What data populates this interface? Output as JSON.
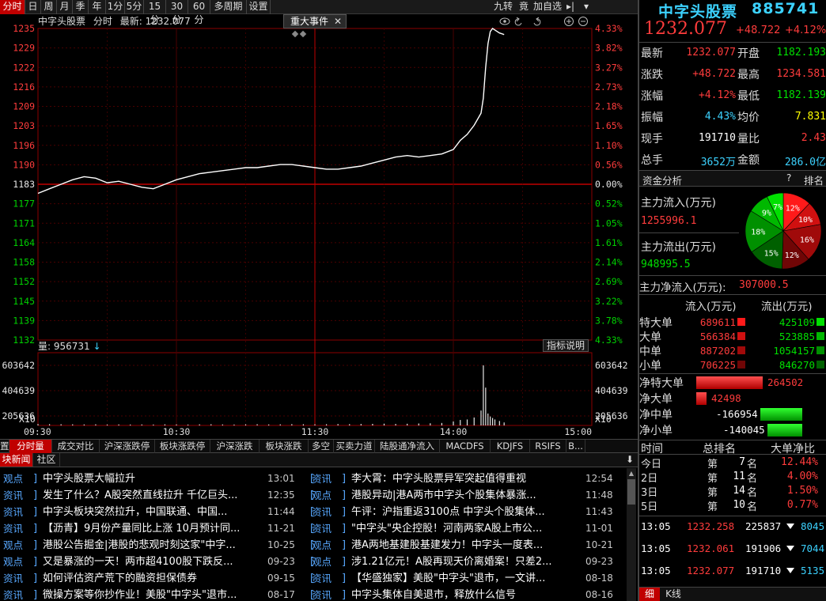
{
  "top_tabs": [
    "分时",
    "日",
    "周",
    "月",
    "季",
    "年",
    "1分",
    "5分",
    "15分",
    "30分",
    "60分",
    "多周期",
    "设置"
  ],
  "top_right_tools": [
    "九转",
    "竟",
    "加自选",
    "▸|",
    "▾"
  ],
  "chart_header": {
    "title": "中字头股票",
    "mode": "分时",
    "latest_label": "最新:",
    "latest_value": "1232.077",
    "event_button": "重大事件",
    "event_close": "✕",
    "icons": [
      "eye-icon",
      "undo-icon",
      "redo-icon",
      "zoom-in-icon",
      "zoom-out-icon"
    ]
  },
  "chart_data": {
    "type": "line",
    "price_axis_ticks": [
      "1235",
      "1229",
      "1222",
      "1216",
      "1209",
      "1203",
      "1196",
      "1190",
      "1183",
      "1177",
      "1171",
      "1164",
      "1158",
      "1152",
      "1145",
      "1139",
      "1132"
    ],
    "pct_axis_ticks": [
      "4.33%",
      "3.82%",
      "3.27%",
      "2.73%",
      "2.18%",
      "1.65%",
      "1.10%",
      "0.56%",
      "0.00%",
      "0.52%",
      "1.05%",
      "1.61%",
      "2.14%",
      "2.69%",
      "3.22%",
      "3.78%",
      "4.33%"
    ],
    "price_range": [
      1132,
      1235
    ],
    "prev_close": 1183,
    "time_ticks": [
      "09:30",
      "10:30",
      "11:30",
      "14:00",
      "15:00"
    ],
    "volume_label": "量:",
    "volume_value": "956731",
    "volume_axis_ticks": [
      "603642",
      "404639",
      "205636",
      "X10"
    ],
    "volume_max": 603642,
    "indicator_button": "指标说明",
    "price_series": [
      [
        0,
        1180.5
      ],
      [
        5,
        1182
      ],
      [
        10,
        1183.5
      ],
      [
        15,
        1185
      ],
      [
        20,
        1186
      ],
      [
        25,
        1185.5
      ],
      [
        30,
        1184
      ],
      [
        35,
        1184.5
      ],
      [
        40,
        1183.5
      ],
      [
        45,
        1182.5
      ],
      [
        50,
        1182
      ],
      [
        55,
        1183.5
      ],
      [
        60,
        1185
      ],
      [
        65,
        1186
      ],
      [
        70,
        1187
      ],
      [
        75,
        1187.5
      ],
      [
        80,
        1188
      ],
      [
        85,
        1188.5
      ],
      [
        90,
        1189
      ],
      [
        95,
        1189
      ],
      [
        100,
        1189.5
      ],
      [
        105,
        1190
      ],
      [
        110,
        1190
      ],
      [
        115,
        1189.5
      ],
      [
        120,
        1189
      ],
      [
        125,
        1188.5
      ],
      [
        130,
        1188.5
      ],
      [
        135,
        1189
      ],
      [
        140,
        1189.5
      ],
      [
        145,
        1190.5
      ],
      [
        150,
        1191.5
      ],
      [
        155,
        1192.5
      ],
      [
        160,
        1193
      ],
      [
        165,
        1192.5
      ],
      [
        170,
        1193
      ],
      [
        175,
        1193.5
      ],
      [
        180,
        1195
      ],
      [
        183,
        1198
      ],
      [
        186,
        1200
      ],
      [
        189,
        1203
      ],
      [
        192,
        1207
      ],
      [
        193,
        1212
      ],
      [
        194,
        1222
      ],
      [
        195,
        1230
      ],
      [
        196,
        1234
      ],
      [
        197,
        1235
      ],
      [
        198,
        1234.5
      ],
      [
        200,
        1233.5
      ],
      [
        202,
        1233
      ]
    ],
    "volume_series": [
      [
        0,
        14000
      ],
      [
        5,
        13000
      ],
      [
        10,
        12000
      ],
      [
        15,
        11000
      ],
      [
        20,
        10000
      ],
      [
        25,
        11000
      ],
      [
        30,
        9000
      ],
      [
        35,
        10000
      ],
      [
        40,
        9000
      ],
      [
        45,
        10000
      ],
      [
        50,
        9000
      ],
      [
        55,
        11000
      ],
      [
        60,
        10000
      ],
      [
        65,
        9000
      ],
      [
        70,
        11000
      ],
      [
        75,
        12000
      ],
      [
        80,
        10000
      ],
      [
        85,
        9000
      ],
      [
        90,
        11000
      ],
      [
        95,
        12000
      ],
      [
        100,
        10000
      ],
      [
        105,
        11000
      ],
      [
        110,
        13000
      ],
      [
        115,
        12000
      ],
      [
        120,
        11000
      ],
      [
        125,
        12000
      ],
      [
        130,
        14000
      ],
      [
        135,
        13000
      ],
      [
        140,
        15000
      ],
      [
        145,
        16000
      ],
      [
        150,
        18000
      ],
      [
        155,
        15000
      ],
      [
        160,
        17000
      ],
      [
        165,
        20000
      ],
      [
        170,
        22000
      ],
      [
        175,
        25000
      ],
      [
        180,
        40000
      ],
      [
        183,
        55000
      ],
      [
        186,
        60000
      ],
      [
        189,
        80000
      ],
      [
        192,
        150000
      ],
      [
        193,
        603642
      ],
      [
        194,
        380000
      ],
      [
        195,
        120000
      ],
      [
        196,
        90000
      ],
      [
        197,
        75000
      ],
      [
        198,
        60000
      ],
      [
        200,
        45000
      ],
      [
        202,
        30000
      ]
    ]
  },
  "analysis_tabs": [
    "置",
    "分时量",
    "成交对比",
    "沪深涨跌停",
    "板块涨跌停",
    "沪深涨跌",
    "板块涨跌",
    "多空",
    "买卖力道",
    "陆股通净流入",
    "MACDFS",
    "KDJFS",
    "RSIFS",
    "B..."
  ],
  "news_tabs": [
    "块新闻",
    "社区"
  ],
  "news_left": [
    {
      "tag": "观点",
      "title": "中字头股票大幅拉升",
      "date": "13:01"
    },
    {
      "tag": "资讯",
      "title": "发生了什么？A股突然直线拉升 千亿巨头...",
      "date": "12:35"
    },
    {
      "tag": "资讯",
      "title": "中字头板块突然拉升，中国联通、中国...",
      "date": "11:44"
    },
    {
      "tag": "资讯",
      "title": "【沥青】9月份产量同比上涨 10月预计同...",
      "date": "11-21"
    },
    {
      "tag": "观点",
      "title": "港股公告掘金|港股的悲观时刻这家\"中字...",
      "date": "10-25"
    },
    {
      "tag": "观点",
      "title": "又是暴涨的一天！两市超4100股下跌反...",
      "date": "09-23"
    },
    {
      "tag": "资讯",
      "title": "如何评估资产荒下的融资担保债券",
      "date": "09-15"
    },
    {
      "tag": "资讯",
      "title": "微操方案等你抄作业！美股\"中字头\"退市...",
      "date": "08-17"
    }
  ],
  "news_right": [
    {
      "tag": "资讯",
      "title": "李大霄：中字头股票异军突起值得重视",
      "date": "12:54"
    },
    {
      "tag": "观点",
      "title": "港股异动|港A两市中字头个股集体暴涨...",
      "date": "11:48"
    },
    {
      "tag": "资讯",
      "title": "午评：沪指重返3100点 中字头个股集体...",
      "date": "11:43"
    },
    {
      "tag": "资讯",
      "title": "\"中字头\"央企控股！河南两家A股上市公...",
      "date": "11-01"
    },
    {
      "tag": "观点",
      "title": "港A两地基建股基建发力！中字头一度表...",
      "date": "10-21"
    },
    {
      "tag": "观点",
      "title": "涉1.21亿元！A股再现天价离婚案！只差2...",
      "date": "09-23"
    },
    {
      "tag": "资讯",
      "title": "【华盛独家】美股\"中字头\"退市，一文讲...",
      "date": "08-18"
    },
    {
      "tag": "资讯",
      "title": "中字头集体自美退市，释放什么信号",
      "date": "08-16"
    }
  ],
  "quote": {
    "name": "中字头股票",
    "code": "885741",
    "price": "1232.077",
    "change": "+48.722",
    "change_pct": "+4.12%",
    "rows": [
      {
        "l1": "最新",
        "v1": "1232.077",
        "l2": "开盘",
        "v2": "1182.193",
        "c1": "red",
        "c2": "green"
      },
      {
        "l1": "涨跌",
        "v1": "+48.722",
        "l2": "最高",
        "v2": "1234.581",
        "c1": "red",
        "c2": "red"
      },
      {
        "l1": "涨幅",
        "v1": "+4.12%",
        "l2": "最低",
        "v2": "1182.139",
        "c1": "red",
        "c2": "green"
      },
      {
        "l1": "振幅",
        "v1": "4.43%",
        "l2": "均价",
        "v2": "7.831",
        "c1": "cyan",
        "c2": "yellow"
      },
      {
        "l1": "现手",
        "v1": "191710",
        "l2": "量比",
        "v2": "2.43",
        "c1": "white",
        "c2": "red"
      },
      {
        "l1": "总手",
        "v1": "3652万",
        "l2": "金额",
        "v2": "286.0亿",
        "c1": "cyan",
        "c2": "cyan"
      }
    ]
  },
  "fund": {
    "header": "资金分析",
    "help": "?",
    "rank": "排名",
    "inflow_label": "主力流入(万元)",
    "inflow_value": "1255996.1",
    "outflow_label": "主力流出(万元)",
    "outflow_value": "948995.5",
    "net_label": "主力净流入(万元):",
    "net_value": "307000.5",
    "pie": [
      {
        "label": "12%",
        "value": 12,
        "color": "#ff1a1a"
      },
      {
        "label": "10%",
        "value": 10,
        "color": "#d01010"
      },
      {
        "label": "16%",
        "value": 16,
        "color": "#a00a0a"
      },
      {
        "label": "12%",
        "value": 12,
        "color": "#700606"
      },
      {
        "label": "15%",
        "value": 15,
        "color": "#006000"
      },
      {
        "label": "18%",
        "value": 18,
        "color": "#009000"
      },
      {
        "label": "9%",
        "value": 9,
        "color": "#00b800"
      },
      {
        "label": "7%",
        "value": 7,
        "color": "#00e000"
      }
    ],
    "flow_head_in": "流入(万元)",
    "flow_head_out": "流出(万元)",
    "flows": [
      {
        "label": "特大单",
        "in": "689611",
        "out": "425109"
      },
      {
        "label": "大单",
        "in": "566384",
        "out": "523885"
      },
      {
        "label": "中单",
        "in": "887202",
        "out": "1054157"
      },
      {
        "label": "小单",
        "in": "706225",
        "out": "846270"
      }
    ],
    "net": [
      {
        "label": "净特大单",
        "value": "264502",
        "num": 264502
      },
      {
        "label": "净大单",
        "value": "42498",
        "num": 42498
      },
      {
        "label": "净中单",
        "value": "-166954",
        "num": -166954
      },
      {
        "label": "净小单",
        "value": "-140045",
        "num": -140045
      }
    ]
  },
  "ranking": {
    "head": [
      "时间",
      "总排名",
      "大单净比"
    ],
    "rows": [
      {
        "period": "今日",
        "rank": "7",
        "ratio": "12.44%"
      },
      {
        "period": "2日",
        "rank": "11",
        "ratio": "4.00%"
      },
      {
        "period": "3日",
        "rank": "14",
        "ratio": "1.50%"
      },
      {
        "period": "5日",
        "rank": "10",
        "ratio": "0.77%"
      }
    ],
    "prefix": "第",
    "suffix": "名"
  },
  "ticks": [
    {
      "time": "13:05",
      "price": "1232.258",
      "vol": "225837",
      "extra": "8045"
    },
    {
      "time": "13:05",
      "price": "1232.061",
      "vol": "191906",
      "extra": "7044"
    },
    {
      "time": "13:05",
      "price": "1232.077",
      "vol": "191710",
      "extra": "5135"
    }
  ],
  "bottom_tabs": [
    "细",
    "K线"
  ]
}
